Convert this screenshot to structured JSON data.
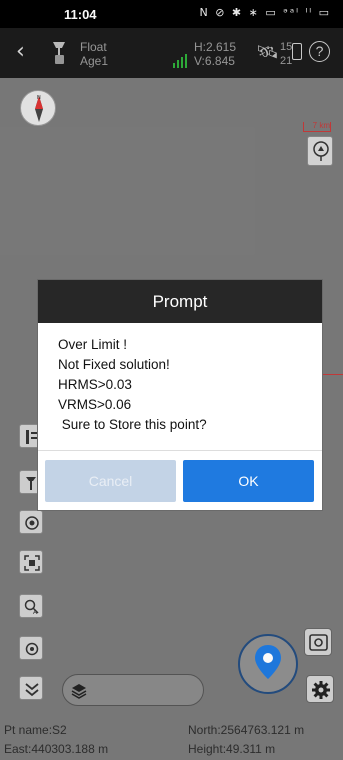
{
  "status_bar": {
    "time": "11:04",
    "icons": "N ⊘ ✱ ∗ ▭ ᵊᵃˡ ˡˡ ▭"
  },
  "top_bar": {
    "fix_type": "Float",
    "age": "Age1",
    "h_precision": "H:2.615",
    "v_precision": "V:6.845",
    "sats_used": "15",
    "sats_visible": "21",
    "help": "?"
  },
  "map": {
    "scale_label": "7 km"
  },
  "dialog": {
    "title": "Prompt",
    "lines": [
      "Over Limit !",
      "Not Fixed solution!",
      "HRMS>0.03",
      "VRMS>0.06",
      " Sure to Store this point?"
    ],
    "cancel_label": "Cancel",
    "ok_label": "OK"
  },
  "info_bar": {
    "pt_name": "Pt name:S2",
    "north": "North:2564763.121 m",
    "east": "East:440303.188 m",
    "height": "Height:49.311 m"
  },
  "colors": {
    "accent_blue": "#1f7ae0",
    "cancel_disabled": "#c3d3e6",
    "dialog_title_bg": "#272727",
    "scale_red": "#c53a3a"
  },
  "icons": [
    "back-icon",
    "receiver-icon",
    "signal-icon",
    "satellite-icon",
    "battery-icon",
    "help-icon",
    "compass-icon",
    "layer-icon",
    "point-list-icon",
    "survey-pole-icon",
    "record-icon",
    "fit-screen-icon",
    "search-point-icon",
    "locate-icon",
    "expand-icon",
    "layers-icon",
    "measure-pin-icon",
    "photo-icon",
    "gear-icon"
  ]
}
